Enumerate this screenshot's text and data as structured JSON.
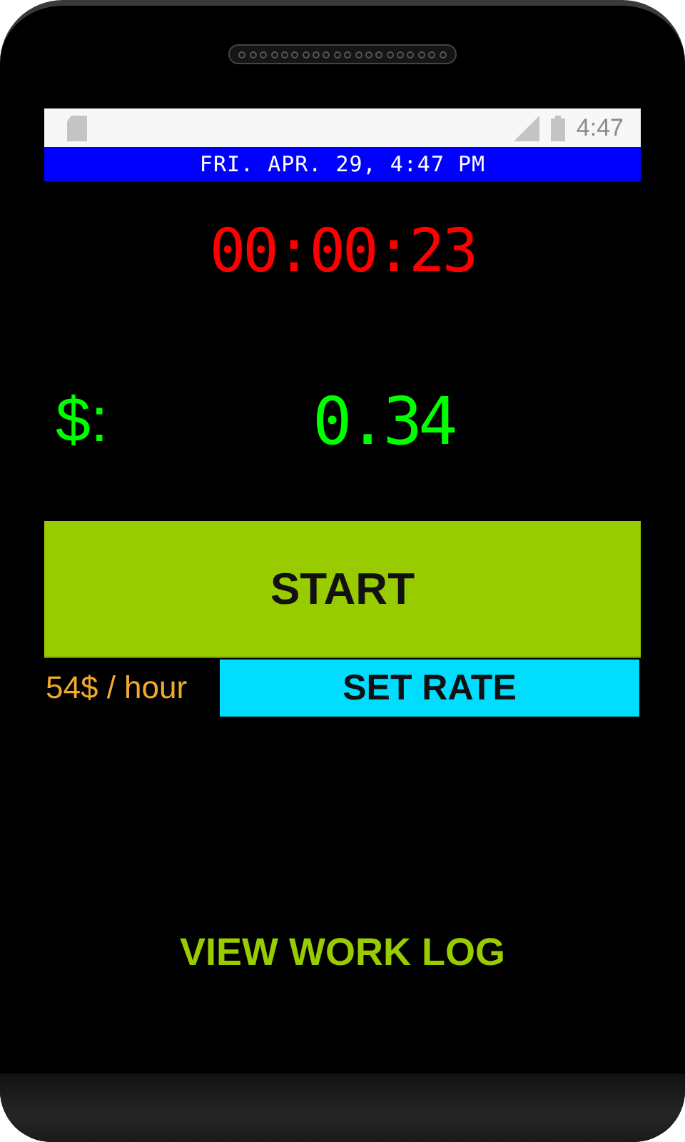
{
  "status_bar": {
    "time": "4:47"
  },
  "date_bar": {
    "text": "FRI. APR. 29, 4:47 PM"
  },
  "timer": {
    "text": "00:00:23"
  },
  "earnings": {
    "label": "$:",
    "value": "0.34"
  },
  "start_button": {
    "label": "START"
  },
  "rate": {
    "text": "54$ / hour",
    "button": "SET RATE"
  },
  "work_log_link": {
    "label": "VIEW WORK LOG"
  }
}
